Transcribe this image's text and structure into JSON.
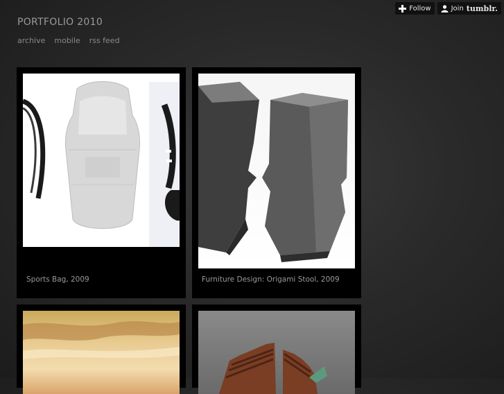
{
  "blog": {
    "title": "PORTFOLIO 2010",
    "nav": [
      {
        "label": "archive"
      },
      {
        "label": "mobile"
      },
      {
        "label": "rss feed"
      }
    ]
  },
  "tumblr_bar": {
    "follow_label": "Follow",
    "join_label": "Join",
    "brand_label": "tumblr."
  },
  "posts": [
    {
      "caption": "Sports Bag, 2009",
      "image": "sports-bag-photo"
    },
    {
      "caption": "Furniture Design: Origami Stool, 2009",
      "image": "origami-stool-photo"
    },
    {
      "caption": "",
      "image": "sunset-sky-photo"
    },
    {
      "caption": "",
      "image": "wooden-structure-photo"
    }
  ]
}
